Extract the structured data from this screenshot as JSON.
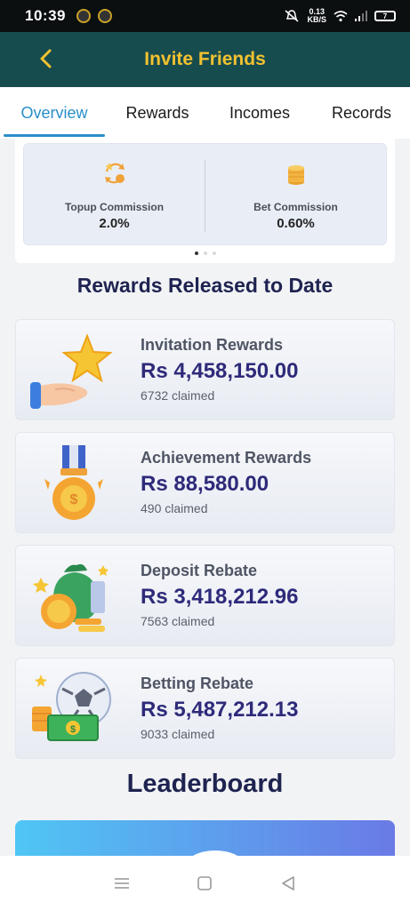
{
  "status_bar": {
    "time": "10:39",
    "net_speed_value": "0.13",
    "net_speed_unit": "KB/S",
    "battery": "7"
  },
  "header": {
    "title": "Invite Friends"
  },
  "tabs": [
    {
      "label": "Overview",
      "active": true
    },
    {
      "label": "Rewards",
      "active": false
    },
    {
      "label": "Incomes",
      "active": false
    },
    {
      "label": "Records",
      "active": false
    }
  ],
  "commission": {
    "topup": {
      "label": "Topup Commission",
      "value": "2.0%"
    },
    "bet": {
      "label": "Bet Commission",
      "value": "0.60%"
    },
    "page_indicator": {
      "current": 1,
      "total": 3
    }
  },
  "rewards_title": "Rewards Released to Date",
  "rewards": [
    {
      "name": "Invitation Rewards",
      "amount": "Rs 4,458,150.00",
      "claimed": "6732 claimed",
      "icon": "star-hand-icon"
    },
    {
      "name": "Achievement Rewards",
      "amount": "Rs 88,580.00",
      "claimed": "490 claimed",
      "icon": "medal-icon"
    },
    {
      "name": "Deposit Rebate",
      "amount": "Rs 3,418,212.96",
      "claimed": "7563 claimed",
      "icon": "money-bag-icon"
    },
    {
      "name": "Betting Rebate",
      "amount": "Rs 5,487,212.13",
      "claimed": "9033 claimed",
      "icon": "soccer-cash-icon"
    }
  ],
  "leaderboard_title": "Leaderboard",
  "colors": {
    "header_bg": "#174c4f",
    "header_title": "#f2c230",
    "tab_active": "#2a8fc9",
    "amount": "#2e2a7a"
  }
}
